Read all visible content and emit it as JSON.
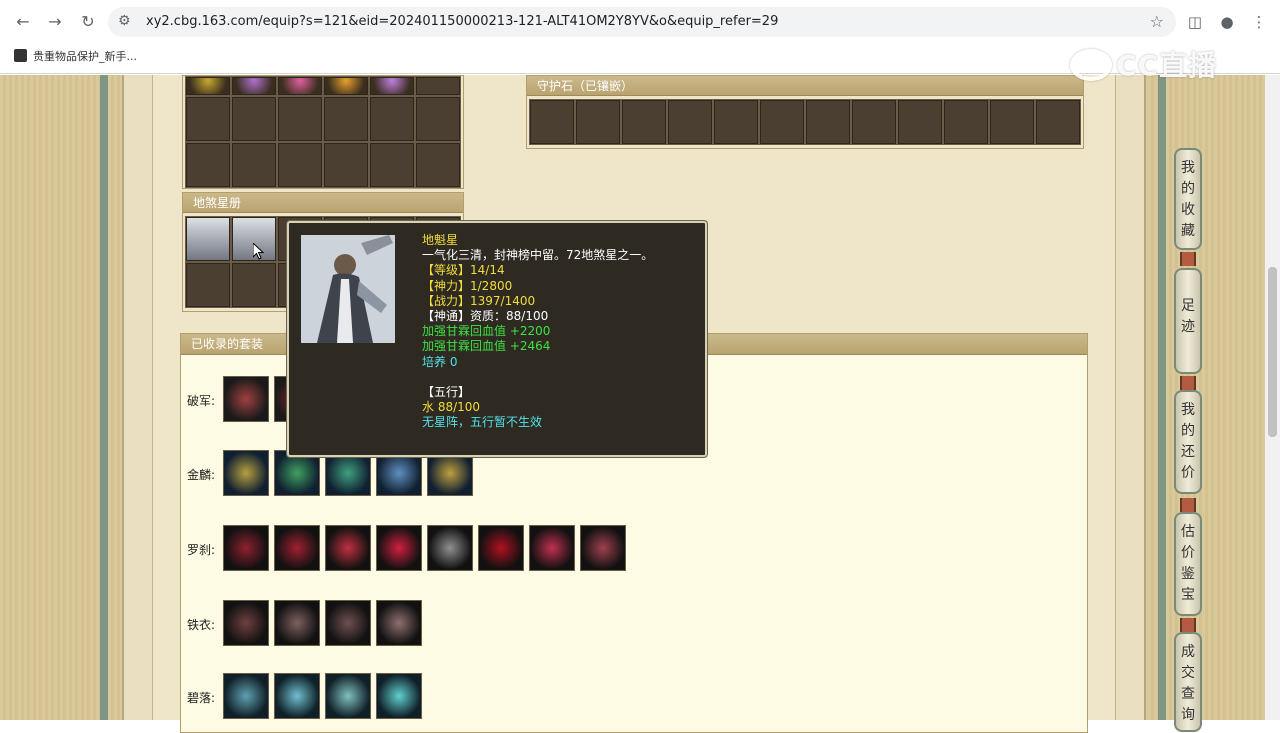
{
  "browser": {
    "url": "xy2.cbg.163.com/equip?s=121&eid=202401150000213-121-ALT41OM2Y8YV&o&equip_refer=29",
    "bookmark": "贵重物品保护_新手...",
    "watermark": "CC直播"
  },
  "panels": {
    "guard_stone": "守护石（已镶嵌）",
    "disha_book": "地煞星册",
    "collected_suits": "已收录的套装"
  },
  "suits": [
    {
      "label": "破军:"
    },
    {
      "label": "金麟:"
    },
    {
      "label": "罗刹:"
    },
    {
      "label": "铁衣:"
    },
    {
      "label": "碧落:"
    }
  ],
  "sidetabs": [
    {
      "label": "我的收藏"
    },
    {
      "label": "足迹"
    },
    {
      "label": "我的还价"
    },
    {
      "label": "估价鉴宝"
    },
    {
      "label": "成交查询"
    }
  ],
  "tooltip": {
    "name": "地魁星",
    "desc": "一气化三清，封神榜中留。72地煞星之一。",
    "level": "【等级】14/14",
    "shenli": "【神力】1/2800",
    "zhanli": "【战力】1397/1400",
    "shentong": "【神通】资质：88/100",
    "bonus1": "加强甘霖回血值 +2200",
    "bonus2": "加强甘霖回血值 +2464",
    "peiyang": "培养 0",
    "wuxing_title": "【五行】",
    "wuxing_value": "水 88/100",
    "wuxing_note": "无星阵，五行暂不生效"
  },
  "colors": {
    "accent_yellow": "#f0dc3c",
    "bonus_green": "#3ee043",
    "cyan": "#52e0e8"
  }
}
